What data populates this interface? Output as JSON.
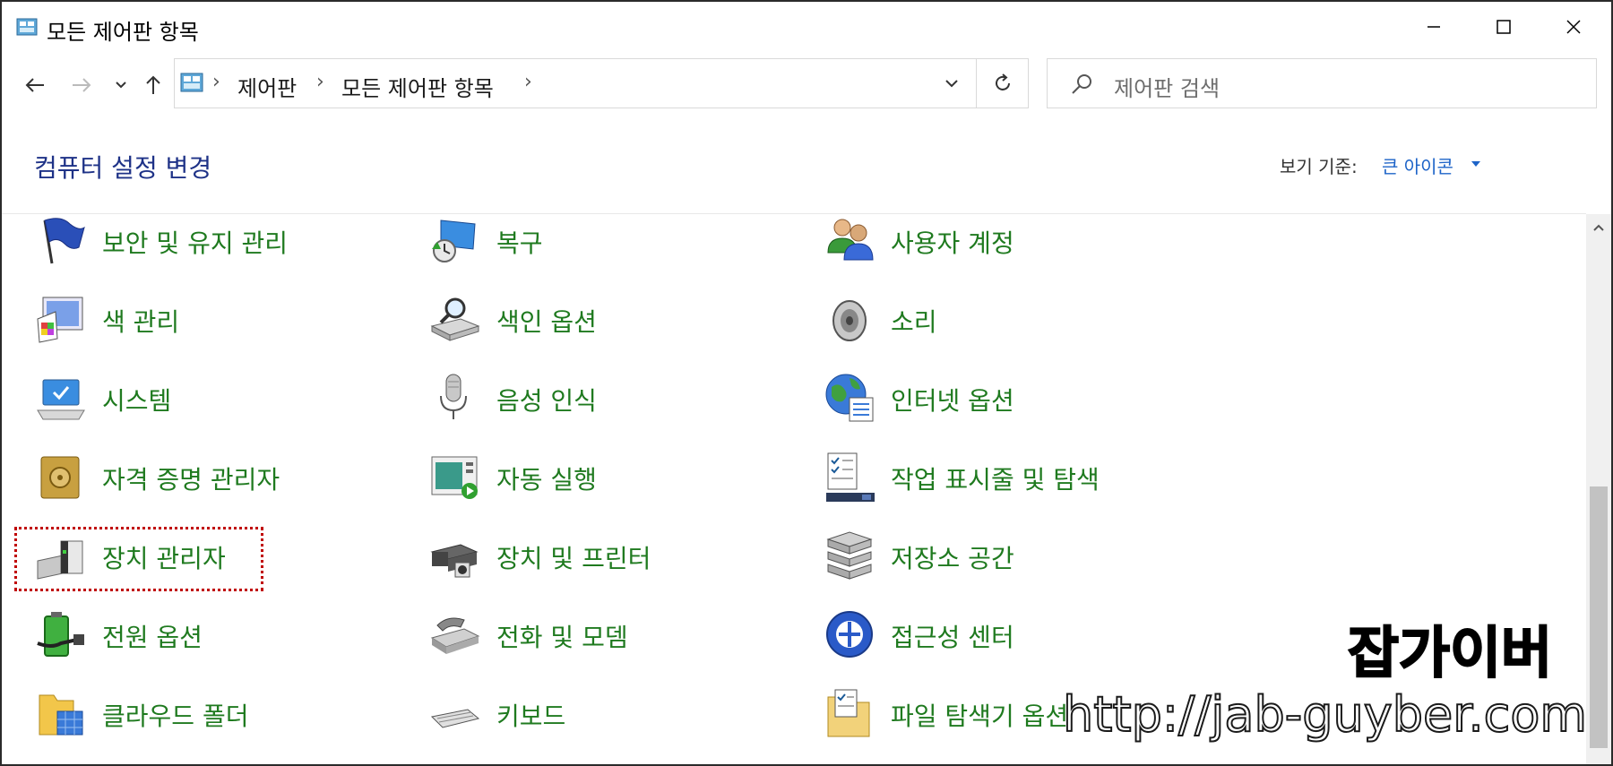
{
  "window": {
    "title": "모든 제어판 항목"
  },
  "nav": {
    "breadcrumbs": [
      "제어판",
      "모든 제어판 항목"
    ],
    "search_placeholder": "제어판 검색"
  },
  "header": {
    "title": "컴퓨터 설정 변경",
    "view_by_label": "보기 기준:",
    "view_by_value": "큰 아이콘"
  },
  "items": [
    {
      "label": "보안 및 유지 관리",
      "icon": "flag-icon"
    },
    {
      "label": "복구",
      "icon": "recovery-icon"
    },
    {
      "label": "사용자 계정",
      "icon": "user-accounts-icon"
    },
    {
      "label": "색 관리",
      "icon": "color-management-icon"
    },
    {
      "label": "색인 옵션",
      "icon": "indexing-icon"
    },
    {
      "label": "소리",
      "icon": "speaker-icon"
    },
    {
      "label": "시스템",
      "icon": "computer-icon"
    },
    {
      "label": "음성 인식",
      "icon": "microphone-icon"
    },
    {
      "label": "인터넷 옵션",
      "icon": "globe-icon"
    },
    {
      "label": "자격 증명 관리자",
      "icon": "vault-icon"
    },
    {
      "label": "자동 실행",
      "icon": "autoplay-icon"
    },
    {
      "label": "작업 표시줄 및 탐색",
      "icon": "taskbar-icon"
    },
    {
      "label": "장치 관리자",
      "icon": "device-manager-icon"
    },
    {
      "label": "장치 및 프린터",
      "icon": "printer-icon"
    },
    {
      "label": "저장소 공간",
      "icon": "storage-icon"
    },
    {
      "label": "전원 옵션",
      "icon": "battery-icon"
    },
    {
      "label": "전화 및 모뎀",
      "icon": "phone-icon"
    },
    {
      "label": "접근성 센터",
      "icon": "accessibility-icon"
    },
    {
      "label": "클라우드 폴더",
      "icon": "cloud-folder-icon"
    },
    {
      "label": "키보드",
      "icon": "keyboard-icon"
    },
    {
      "label": "파일 탐색기 옵션",
      "icon": "folder-options-icon"
    }
  ],
  "watermark": {
    "title": "잡가이버",
    "url": "http://jab-guyber.com"
  },
  "colors": {
    "link_green": "#1f7a1f",
    "heading_blue": "#1e3287",
    "highlight_red": "#c00000"
  }
}
